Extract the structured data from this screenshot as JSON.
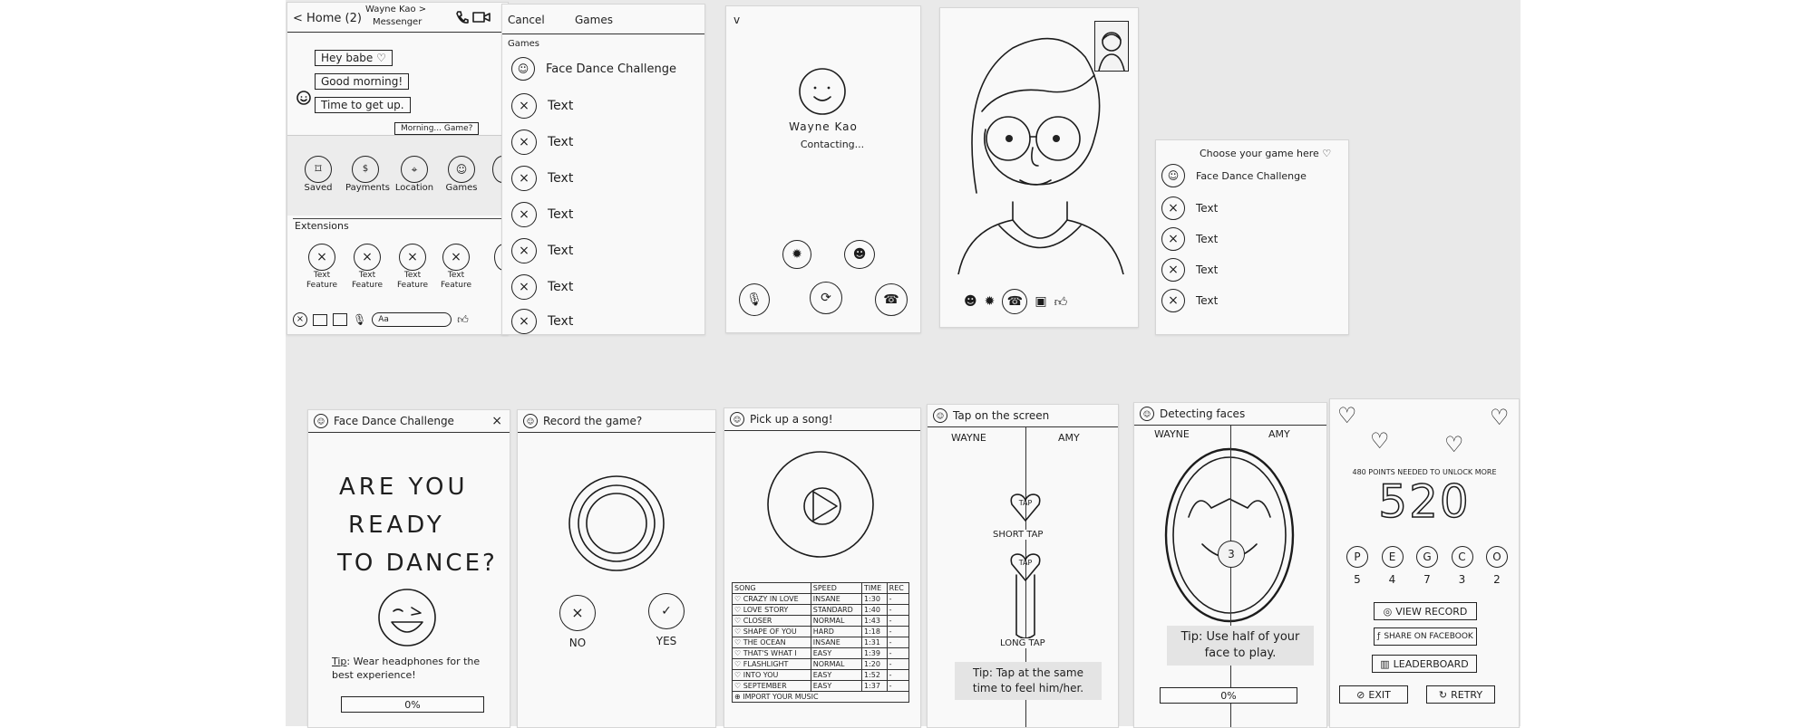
{
  "messenger": {
    "back_label": "< Home (2)",
    "contact_name": "Wayne Kao >",
    "app_name": "Messenger",
    "messages": [
      "Hey babe ♡",
      "Good morning!",
      "Time to get up."
    ],
    "partial_message": "Morning... Game?",
    "shortcuts": [
      {
        "label": "Saved",
        "icon": "bookmark-icon"
      },
      {
        "label": "Payments",
        "icon": "dollar-icon"
      },
      {
        "label": "Location",
        "icon": "location-pin-icon"
      },
      {
        "label": "Games",
        "icon": "gamepad-icon"
      }
    ],
    "extensions_title": "Extensions",
    "extensions": [
      {
        "label": "Text Feature"
      },
      {
        "label": "Text Feature"
      },
      {
        "label": "Text Feature"
      },
      {
        "label": "Text Feature"
      }
    ],
    "input_placeholder": "Aa"
  },
  "games_list": {
    "cancel_label": "Cancel",
    "title": "Games",
    "section_label": "Games",
    "featured": "Face Dance Challenge",
    "items": [
      "Text",
      "Text",
      "Text",
      "Text",
      "Text",
      "Text",
      "Text"
    ]
  },
  "call": {
    "collapse_label": "v",
    "name": "Wayne Kao",
    "status": "Contacting..."
  },
  "game_picker": {
    "title": "Choose your game here ♡",
    "featured": "Face Dance Challenge",
    "items": [
      "Text",
      "Text",
      "Text",
      "Text"
    ]
  },
  "ready": {
    "header": "Face Dance Challenge",
    "close_label": "×",
    "headline": [
      "ARE YOU",
      "READY",
      "TO DANCE?"
    ],
    "tip_label": "Tip",
    "tip_text": ": Wear headphones for the best experience!",
    "progress_label": "0%",
    "progress": 0
  },
  "record": {
    "header": "Record the game?",
    "no_label": "NO",
    "yes_label": "YES"
  },
  "song": {
    "header": "Pick up a song!",
    "columns": [
      "SONG",
      "SPEED",
      "TIME",
      "REC"
    ],
    "rows": [
      {
        "song": "CRAZY IN LOVE",
        "speed": "INSANE",
        "time": "1:30",
        "rec": "-"
      },
      {
        "song": "LOVE STORY",
        "speed": "STANDARD",
        "time": "1:40",
        "rec": "-"
      },
      {
        "song": "CLOSER",
        "speed": "NORMAL",
        "time": "1:43",
        "rec": "-"
      },
      {
        "song": "SHAPE OF YOU",
        "speed": "HARD",
        "time": "1:18",
        "rec": "-"
      },
      {
        "song": "THE OCEAN",
        "speed": "INSANE",
        "time": "1:31",
        "rec": "-"
      },
      {
        "song": "THAT'S WHAT I",
        "speed": "EASY",
        "time": "1:39",
        "rec": "-"
      },
      {
        "song": "FLASHLIGHT",
        "speed": "NORMAL",
        "time": "1:20",
        "rec": "-"
      },
      {
        "song": "INTO YOU",
        "speed": "EASY",
        "time": "1:52",
        "rec": "-"
      },
      {
        "song": "SEPTEMBER",
        "speed": "EASY",
        "time": "1:37",
        "rec": "-"
      }
    ],
    "import_label": "IMPORT YOUR MUSIC"
  },
  "tap": {
    "header": "Tap on the screen",
    "left_player": "WAYNE",
    "right_player": "AMY",
    "heart_label": "TAP",
    "short_tap": "SHORT TAP",
    "long_tap": "LONG TAP",
    "tip": "Tip: Tap at the same time to feel him/her."
  },
  "detect": {
    "header": "Detecting faces",
    "left_player": "WAYNE",
    "right_player": "AMY",
    "countdown": "3",
    "tip": "Tip: Use half of your face to play.",
    "progress_label": "0%",
    "progress": 0
  },
  "score": {
    "unlock_note": "480 POINTS NEEDED TO UNLOCK MORE",
    "score": "520",
    "grades": [
      {
        "letter": "P",
        "count": "5"
      },
      {
        "letter": "E",
        "count": "4"
      },
      {
        "letter": "G",
        "count": "7"
      },
      {
        "letter": "C",
        "count": "3"
      },
      {
        "letter": "O",
        "count": "2"
      }
    ],
    "view_record": "VIEW RECORD",
    "share": "SHARE ON FACEBOOK",
    "leaderboard": "LEADERBOARD",
    "exit": "EXIT",
    "retry": "RETRY"
  }
}
